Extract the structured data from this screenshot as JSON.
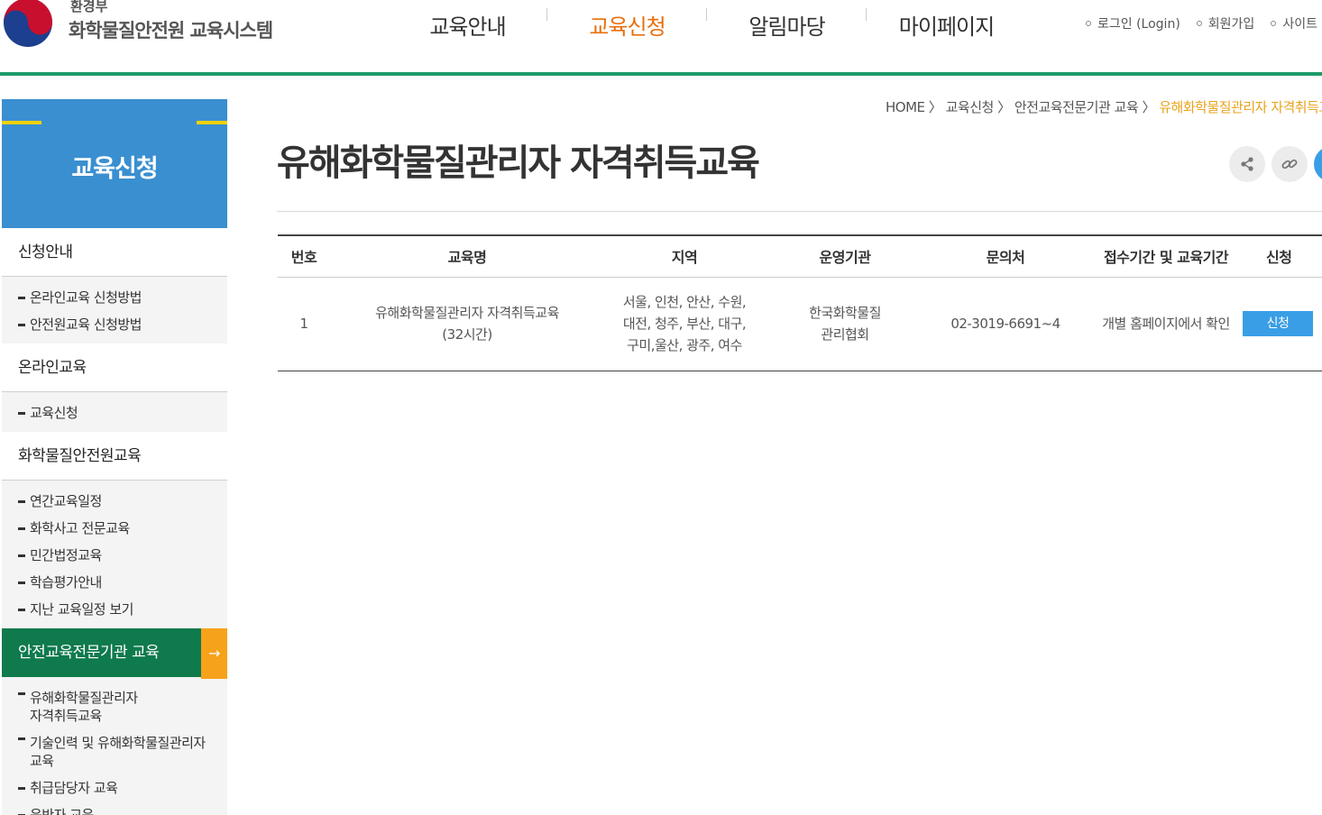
{
  "header": {
    "ministry": "환경부",
    "site_title": "화학물질안전원 교육시스템",
    "gnb": [
      "교육안내",
      "교육신청",
      "알림마당",
      "마이페이지"
    ],
    "util": [
      "로그인 (Login)",
      "회원가입",
      "사이트"
    ]
  },
  "sidebar": {
    "title": "교육신청",
    "groups": [
      {
        "label": "신청안내",
        "items": [
          "온라인교육 신청방법",
          "안전원교육 신청방법"
        ]
      },
      {
        "label": "온라인교육",
        "items": [
          "교육신청"
        ]
      },
      {
        "label": "화학물질안전원교육",
        "items": [
          "연간교육일정",
          "화학사고 전문교육",
          "민간법정교육",
          "학습평가안내",
          "지난 교육일정 보기"
        ]
      },
      {
        "label": "안전교육전문기관 교육",
        "items": [
          "유해화학물질관리자\n자격취득교육",
          "기술인력 및 유해화학물질관리자\n교육",
          "취급담당자 교육",
          "운반자 교육"
        ]
      }
    ],
    "active_arrow": "→"
  },
  "breadcrumb": {
    "home": "HOME",
    "sep": "〉",
    "path": [
      "교육신청",
      "안전교육전문기관 교육"
    ],
    "current": "유해화학물질관리자 자격취득교육"
  },
  "page": {
    "title": "유해화학물질관리자 자격취득교육"
  },
  "table": {
    "headers": [
      "번호",
      "교육명",
      "지역",
      "운영기관",
      "문의처",
      "접수기간 및 교육기간",
      "신청"
    ],
    "rows": [
      {
        "no": "1",
        "name": "유해화학물질관리자 자격취득교육\n(32시간)",
        "region": "서울, 인천, 안산, 수원,\n대전, 청주, 부산, 대구,\n구미,울산, 광주, 여수",
        "org": "한국화학물질\n관리협회",
        "contact": "02-3019-6691~4",
        "period": "개별 홈페이지에서 확인",
        "apply": "신청"
      }
    ]
  },
  "colors": {
    "accent_orange": "#e8700e",
    "header_rule": "#1e9a6a",
    "side_head": "#3a8fd0",
    "side_active": "#0f7a4c",
    "apply_button": "#3a9ee6"
  }
}
